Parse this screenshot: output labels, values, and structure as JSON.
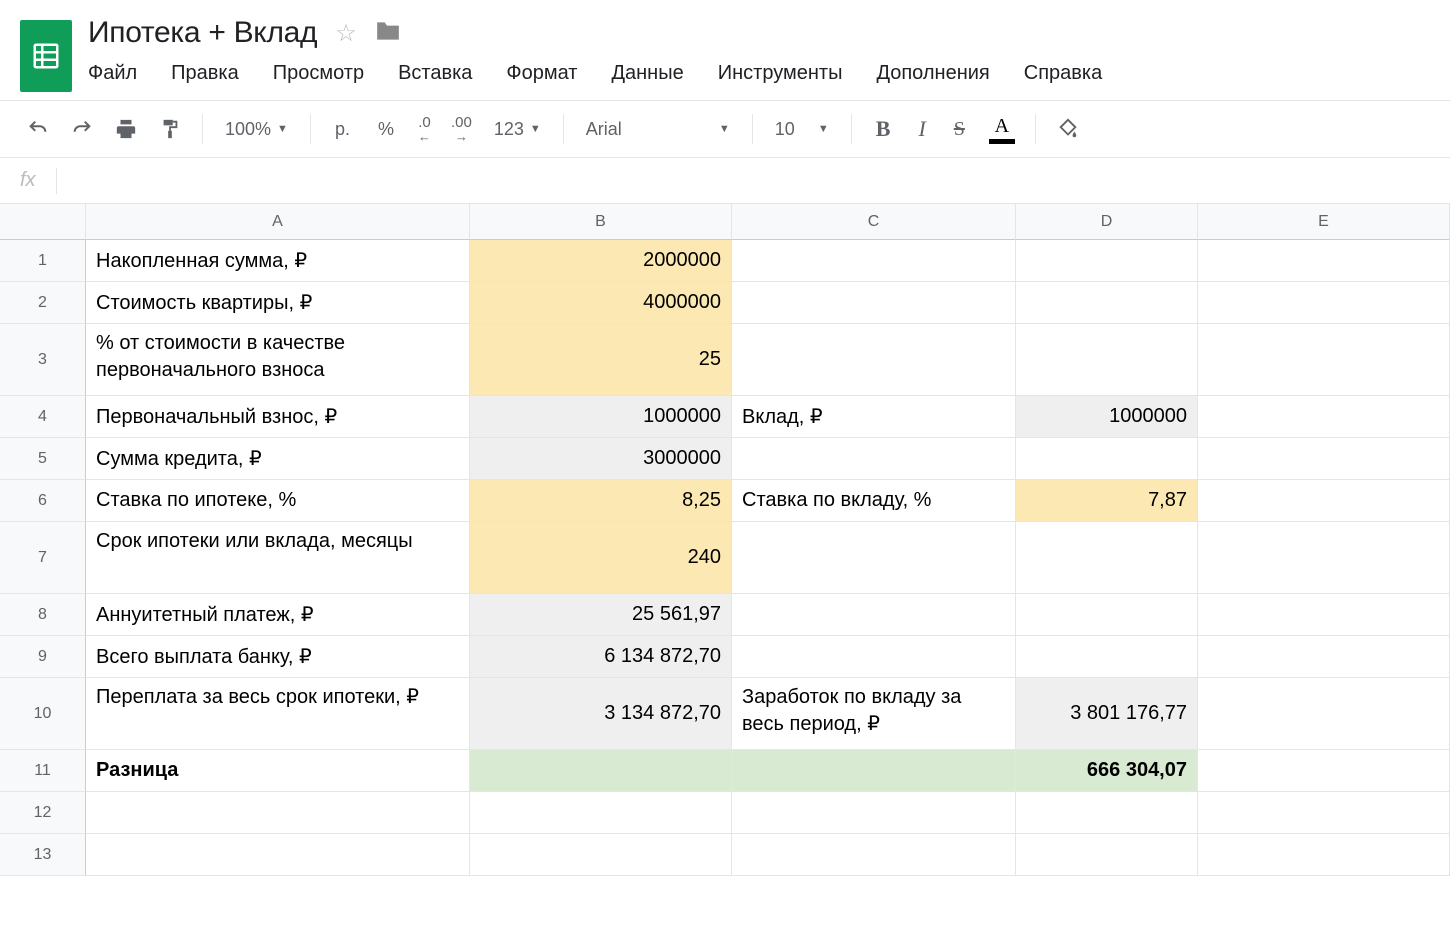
{
  "doc": {
    "title": "Ипотека + Вклад"
  },
  "menu": {
    "file": "Файл",
    "edit": "Правка",
    "view": "Просмотр",
    "insert": "Вставка",
    "format": "Формат",
    "data": "Данные",
    "tools": "Инструменты",
    "addons": "Дополнения",
    "help": "Справка"
  },
  "toolbar": {
    "zoom": "100%",
    "currency": "р.",
    "percent": "%",
    "dec_dec": ".0",
    "inc_dec": ".00",
    "more_fmt": "123",
    "font": "Arial",
    "font_size": "10",
    "bold": "B",
    "italic": "I",
    "strike": "S",
    "text_color": "A"
  },
  "formula_bar": {
    "fx": "fx",
    "value": ""
  },
  "columns": [
    "A",
    "B",
    "C",
    "D",
    "E"
  ],
  "rows": [
    {
      "n": "1",
      "h": "row-h1",
      "A": "Накопленная сумма, ₽",
      "B": "2000000",
      "B_cls": "bg-yellow",
      "C": "",
      "D": "",
      "E": ""
    },
    {
      "n": "2",
      "h": "row-h1",
      "A": "Стоимость квартиры, ₽",
      "B": "4000000",
      "B_cls": "bg-yellow",
      "C": "",
      "D": "",
      "E": ""
    },
    {
      "n": "3",
      "h": "row-h2",
      "A": "% от стоимости в качестве первоначального взноса",
      "A_wrap": true,
      "B": "25",
      "B_cls": "bg-yellow",
      "C": "",
      "D": "",
      "E": ""
    },
    {
      "n": "4",
      "h": "row-h1",
      "A": "Первоначальный взнос, ₽",
      "B": "1000000",
      "B_cls": "bg-gray",
      "C": "Вклад, ₽",
      "D": "1000000",
      "D_cls": "bg-gray",
      "E": ""
    },
    {
      "n": "5",
      "h": "row-h1",
      "A": "Сумма кредита, ₽",
      "B": "3000000",
      "B_cls": "bg-gray",
      "C": "",
      "D": "",
      "E": ""
    },
    {
      "n": "6",
      "h": "row-h1",
      "A": "Ставка по ипотеке, %",
      "B": "8,25",
      "B_cls": "bg-yellow",
      "C": "Ставка по вкладу, %",
      "D": "7,87",
      "D_cls": "bg-yellow",
      "E": ""
    },
    {
      "n": "7",
      "h": "row-h2",
      "A": "Срок ипотеки или вклада, месяцы",
      "A_wrap": true,
      "B": "240",
      "B_cls": "bg-yellow",
      "C": "",
      "D": "",
      "E": ""
    },
    {
      "n": "8",
      "h": "row-h1",
      "A": "Аннуитетный платеж, ₽",
      "B": "25 561,97",
      "B_cls": "bg-gray",
      "C": "",
      "D": "",
      "E": ""
    },
    {
      "n": "9",
      "h": "row-h1",
      "A": "Всего выплата банку, ₽",
      "B": "6 134 872,70",
      "B_cls": "bg-gray",
      "C": "",
      "D": "",
      "E": ""
    },
    {
      "n": "10",
      "h": "row-h2",
      "A": "Переплата за весь срок ипотеки, ₽",
      "A_wrap": true,
      "B": "3 134 872,70",
      "B_cls": "bg-gray",
      "C": "Заработок по вкладу за весь период, ₽",
      "C_wrap": true,
      "D": "3 801 176,77",
      "D_cls": "bg-gray",
      "E": ""
    },
    {
      "n": "11",
      "h": "row-h1",
      "A": "Разница",
      "A_bold": true,
      "B": "",
      "B_cls": "bg-green",
      "C": "",
      "C_cls": "bg-green",
      "D": "666 304,07",
      "D_cls": "bg-green",
      "D_bold": true,
      "E": ""
    },
    {
      "n": "12",
      "h": "row-h1",
      "A": "",
      "B": "",
      "C": "",
      "D": "",
      "E": ""
    },
    {
      "n": "13",
      "h": "row-h1",
      "A": "",
      "B": "",
      "C": "",
      "D": "",
      "E": ""
    }
  ]
}
